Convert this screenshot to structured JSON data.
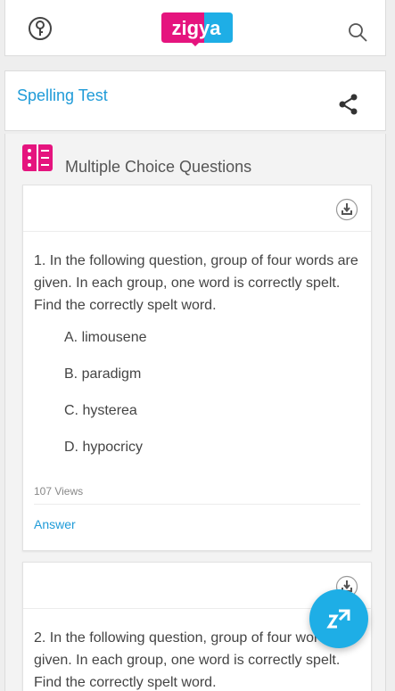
{
  "header": {
    "logo_text": "zigya"
  },
  "page": {
    "title": "Spelling Test"
  },
  "section": {
    "title": "Multiple Choice Questions"
  },
  "questions": [
    {
      "text": "1.  In the following question, group of four words are given. In each group, one word is correctly spelt. Find the correctly spelt word.",
      "options": [
        "A. limousene",
        "B. paradigm",
        "C. hysterea",
        "D. hypocricy"
      ],
      "views": "107 Views",
      "answer_label": "Answer"
    },
    {
      "text": "2.  In the following question, group of four words are given. In each group, one word is correctly spelt. Find the correctly spelt word."
    }
  ],
  "colors": {
    "accent": "#1f9bd8",
    "brand_pink": "#e5147e",
    "fab": "#1eaee6"
  }
}
